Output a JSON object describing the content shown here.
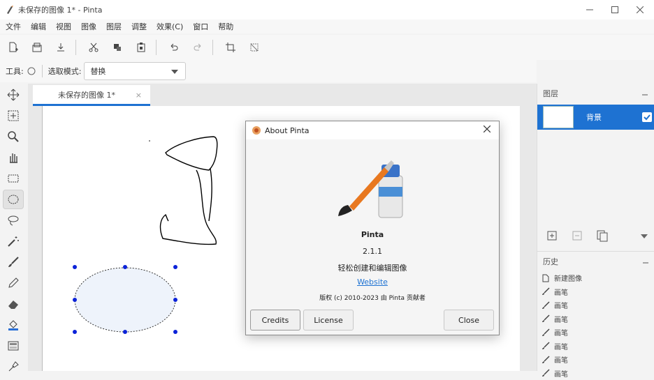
{
  "window": {
    "title": "未保存的图像 1* - Pinta"
  },
  "menu": [
    "文件",
    "编辑",
    "视图",
    "图像",
    "图层",
    "调整",
    "效果(C)",
    "窗口",
    "帮助"
  ],
  "options": {
    "tool_label": "工具:",
    "select_mode_label": "选取模式:",
    "select_mode_value": "替换"
  },
  "tab": {
    "label": "未保存的图像 1*",
    "close": "×"
  },
  "layers": {
    "header": "图层",
    "items": [
      {
        "name": "背景",
        "visible": true
      }
    ]
  },
  "history": {
    "header": "历史",
    "items": [
      "新建图像",
      "画笔",
      "画笔",
      "画笔",
      "画笔",
      "画笔",
      "画笔",
      "画笔"
    ]
  },
  "about": {
    "title": "About Pinta",
    "app_name": "Pinta",
    "version": "2.1.1",
    "tagline": "轻松创建和编辑图像",
    "website": "Website",
    "copyright": "版权 (c) 2010-2023 由 Pinta 贡献者",
    "buttons": {
      "credits": "Credits",
      "license": "License",
      "close": "Close"
    }
  },
  "colors": {
    "accent": "#1e72d2",
    "selection_fill": "#eef3fb",
    "handle": "#0b22d8"
  }
}
